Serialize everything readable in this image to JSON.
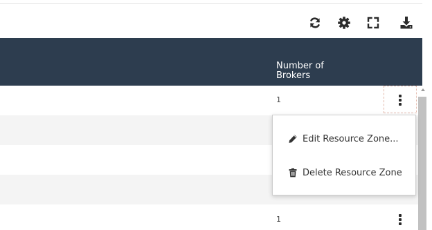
{
  "table": {
    "column_header": "Number of Brokers",
    "rows": [
      {
        "brokers": "1"
      },
      {
        "brokers": ""
      },
      {
        "brokers": ""
      },
      {
        "brokers": ""
      },
      {
        "brokers": "1"
      }
    ]
  },
  "toolbar": {
    "icons": [
      "refresh-icon",
      "gear-icon",
      "fullscreen-icon",
      "download-icon"
    ]
  },
  "context_menu": {
    "items": [
      {
        "label": "Edit Resource Zone...",
        "icon": "pencil-icon"
      },
      {
        "label": "Delete Resource Zone",
        "icon": "trash-icon"
      }
    ]
  },
  "colors": {
    "header_bg": "#2d3d4f",
    "alt_row_bg": "#f4f4f4"
  }
}
